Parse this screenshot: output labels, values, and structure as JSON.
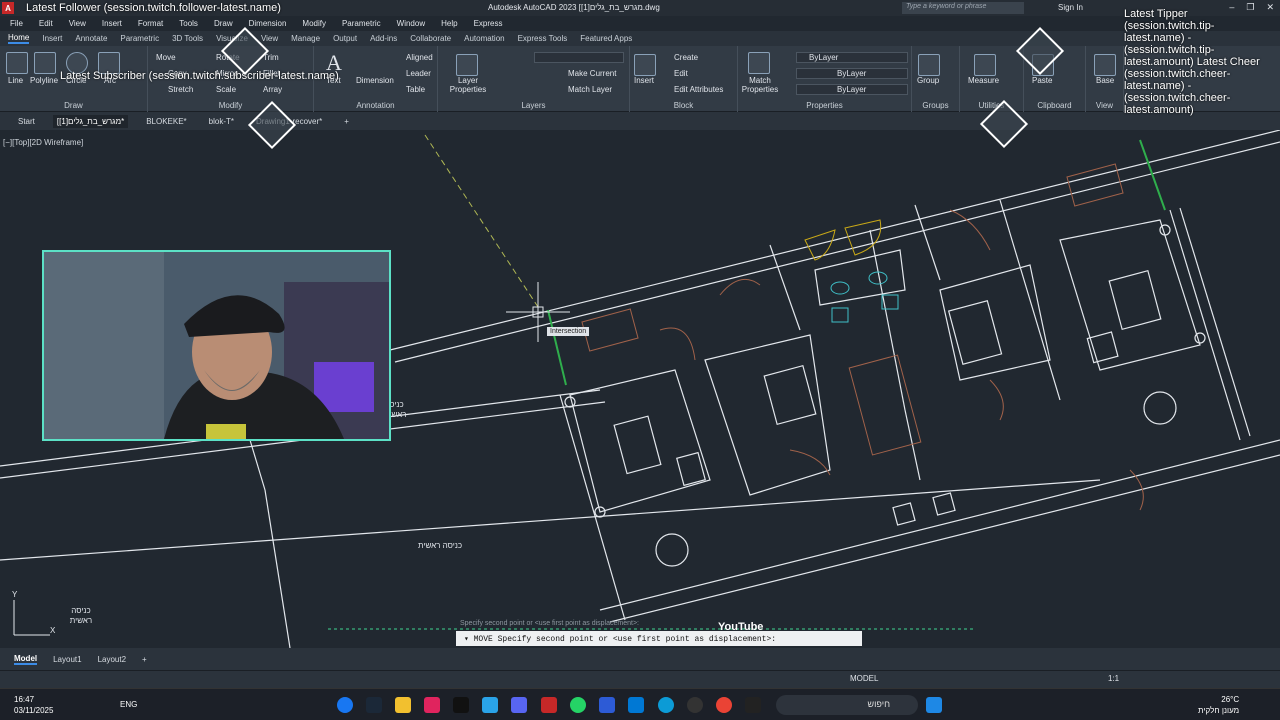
{
  "app": {
    "title": "Autodesk AutoCAD 2023   [מגרש_בת_גלים[1].dwg",
    "logo": "A",
    "search_placeholder": "Type a keyword or phrase",
    "sign_in": "Sign In"
  },
  "menu": [
    "File",
    "Edit",
    "View",
    "Insert",
    "Format",
    "Tools",
    "Draw",
    "Dimension",
    "Modify",
    "Parametric",
    "Window",
    "Help",
    "Express"
  ],
  "ribbon_tabs": [
    "Home",
    "Insert",
    "Annotate",
    "Parametric",
    "3D Tools",
    "Visualize",
    "View",
    "Manage",
    "Output",
    "Add-ins",
    "Collaborate",
    "Automation",
    "Express Tools",
    "Featured Apps"
  ],
  "ribbon": {
    "draw": {
      "title": "Draw",
      "line": "Line",
      "polyline": "Polyline",
      "circle": "Circle",
      "arc": "Arc"
    },
    "modify": {
      "title": "Modify",
      "move": "Move",
      "rotate": "Rotate",
      "trim": "Trim",
      "copy": "Copy",
      "mirror": "Mirror",
      "fillet": "Fillet",
      "stretch": "Stretch",
      "scale": "Scale",
      "array": "Array"
    },
    "annotation": {
      "title": "Annotation",
      "text": "Text",
      "dimension": "Dimension",
      "aligned": "Aligned",
      "leader": "Leader",
      "table": "Table"
    },
    "layers": {
      "title": "Layers",
      "layer_props": "Layer Properties",
      "make_current": "Make Current",
      "match_layer": "Match Layer"
    },
    "block": {
      "title": "Block",
      "insert": "Insert",
      "create": "Create",
      "edit": "Edit",
      "edit_attributes": "Edit Attributes"
    },
    "properties": {
      "title": "Properties",
      "match": "Match Properties",
      "bylayer1": "ByLayer",
      "bylayer2": "ByLayer",
      "bylayer3": "ByLayer"
    },
    "groups": {
      "title": "Groups",
      "group": "Group"
    },
    "utilities": {
      "title": "Utilities",
      "measure": "Measure"
    },
    "clipboard": {
      "title": "Clipboard",
      "paste": "Paste"
    },
    "view": {
      "title": "View",
      "base": "Base"
    }
  },
  "doc_tabs": [
    "Start",
    "[מגרש_בת_גלים[1]*",
    "BLOKEKE*",
    "blok-T*",
    "Drawing1-recover*"
  ],
  "viewport_label": "[−][Top][2D Wireframe]",
  "tooltip": "Intersection",
  "command": {
    "prompt": "▾ MOVE Specify second point or <use first point as displacement>:",
    "previous": "Specify second point or <use first point as displacement>:"
  },
  "overlays": {
    "follower": "Latest Follower (session.twitch.follower-latest.name)",
    "subscriber": "Latest Subscriber (session.twitch.subscriber-latest.name)",
    "tipper_cheer": "Latest Tipper (session.twitch.tip-latest.name) - (session.twitch.tip-latest.amount) Latest Cheer (session.twitch.cheer-latest.name) - (session.twitch.cheer-latest.amount)",
    "youtube": "YouTube"
  },
  "drawing_labels": {
    "entrance1": "כניסה ראשית",
    "entrance2": "כניסה ראשית",
    "entrance3": "כניסה ראשית"
  },
  "layout_tabs": [
    "Model",
    "Layout1",
    "Layout2",
    "+"
  ],
  "status": {
    "model": "MODEL",
    "scale": "1:1"
  },
  "taskbar": {
    "time": "16:47",
    "date": "03/11/2025",
    "lang": "ENG",
    "search": "חיפוש",
    "temp": "26°C",
    "weather": "מעונן חלקית"
  },
  "colors": {
    "accent": "#3c8ce7",
    "canvas": "#212830",
    "webcam_border": "#5ce1c6",
    "drawing_lines": "#e3e7ec"
  }
}
